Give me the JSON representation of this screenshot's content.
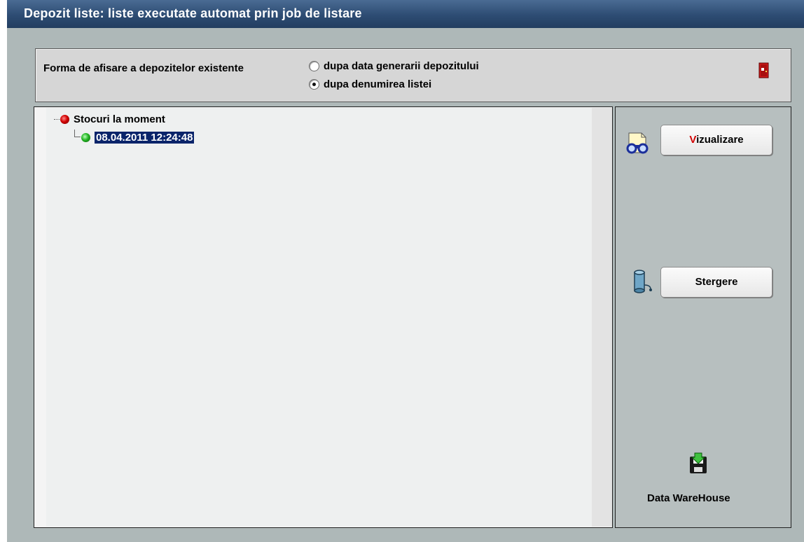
{
  "window": {
    "title": "Depozit liste: liste executate automat prin job de listare"
  },
  "display_form": {
    "label": "Forma de afisare a depozitelor existente",
    "options": [
      {
        "label": "dupa data generarii depozitului",
        "checked": false
      },
      {
        "label": "dupa denumirea listei",
        "checked": true
      }
    ]
  },
  "tree": {
    "root": {
      "label": "Stocuri  la moment",
      "status": "red"
    },
    "children": [
      {
        "label": "08.04.2011 12:24:48",
        "status": "green",
        "selected": true
      }
    ]
  },
  "actions": {
    "view": {
      "accel": "V",
      "rest": "izualizare"
    },
    "delete": {
      "label": "Stergere"
    },
    "warehouse": {
      "label": "Data WareHouse"
    }
  },
  "colors": {
    "title_bar": "#2d4c73",
    "selection": "#0a246a",
    "accelerator": "#d10000"
  },
  "icons": [
    "exit-door-icon",
    "binoculars-icon",
    "database-delete-icon",
    "floppy-save-icon"
  ]
}
